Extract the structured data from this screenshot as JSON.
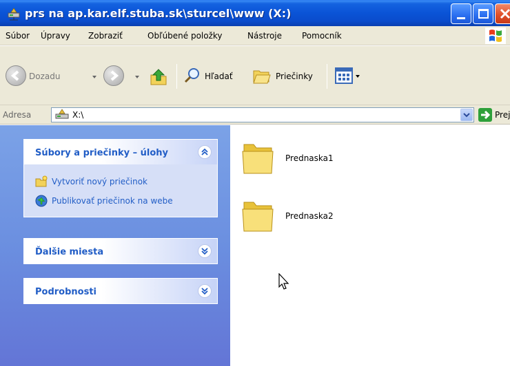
{
  "window": {
    "title": "prs na ap.kar.elf.stuba.sk\\sturcel\\www (X:)"
  },
  "menu": {
    "items": [
      "Súbor",
      "Úpravy",
      "Zobraziť",
      "Obľúbené položky",
      "Nástroje",
      "Pomocník"
    ]
  },
  "toolbar": {
    "back_label": "Dozadu",
    "search_label": "Hľadať",
    "folders_label": "Priečinky"
  },
  "address": {
    "label": "Adresa",
    "value": "X:\\",
    "go_label": "Prejsť"
  },
  "taskpane": {
    "tasks_title": "Súbory a priečinky – úlohy",
    "tasks": [
      {
        "label": "Vytvoriť nový priečinok",
        "icon": "new-folder-icon"
      },
      {
        "label": "Publikovať priečinok na webe",
        "icon": "publish-web-icon"
      }
    ],
    "other_places_title": "Ďalšie miesta",
    "details_title": "Podrobnosti"
  },
  "content": {
    "items": [
      {
        "name": "Prednaska1",
        "icon": "folder-icon"
      },
      {
        "name": "Prednaska2",
        "icon": "folder-icon"
      }
    ]
  },
  "colors": {
    "titlebar": "#0a53d6",
    "taskpane": "#6b8fe0",
    "link": "#215dc6",
    "chrome": "#ece9d8"
  }
}
